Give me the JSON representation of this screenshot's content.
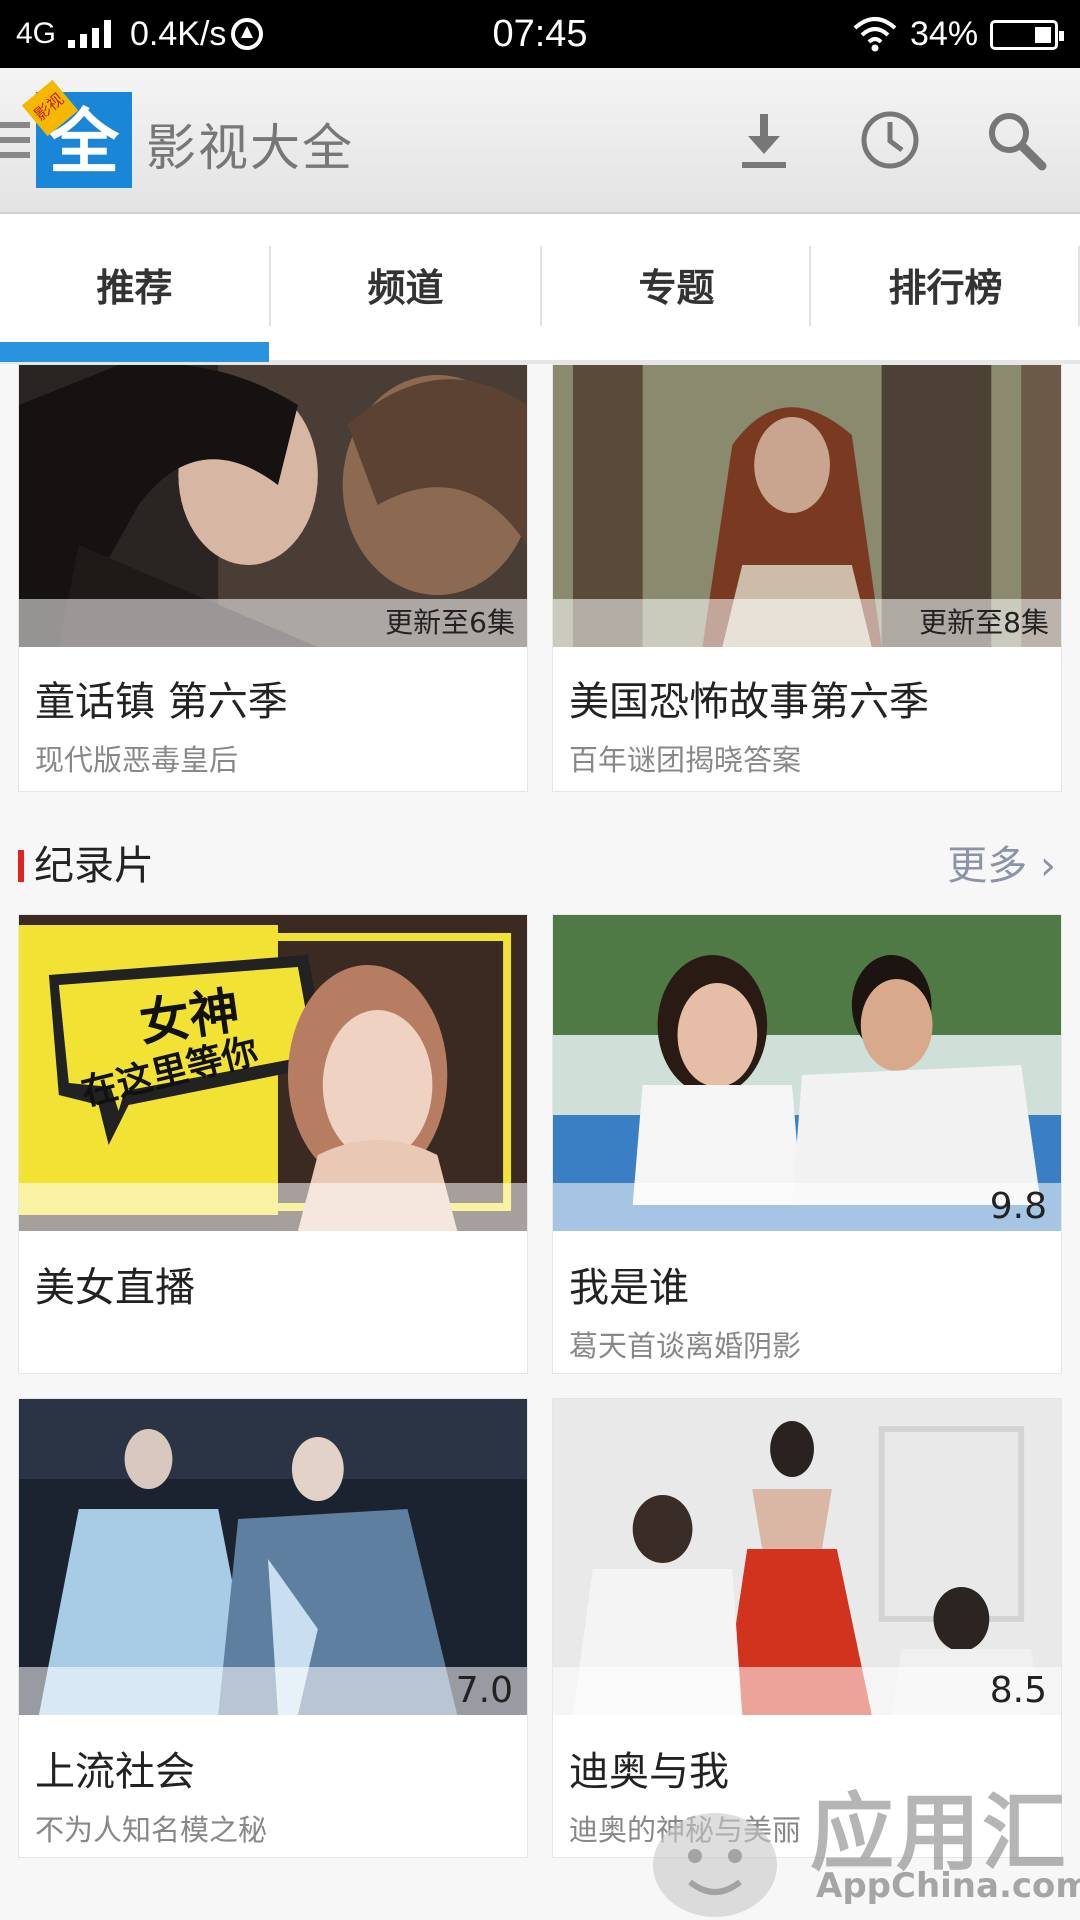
{
  "status_bar": {
    "network": "4G",
    "speed": "0.4K/s",
    "time": "07:45",
    "battery": "34%"
  },
  "app_bar": {
    "logo_char": "全",
    "logo_tag": "影视",
    "title": "影视大全"
  },
  "tabs": [
    "推荐",
    "频道",
    "专题",
    "排行榜"
  ],
  "top_cards": [
    {
      "title": "童话镇 第六季",
      "subtitle": "现代版恶毒皇后",
      "badge": "更新至6集"
    },
    {
      "title": "美国恐怖故事第六季",
      "subtitle": "百年谜团揭晓答案",
      "badge": "更新至8集"
    }
  ],
  "section": {
    "title": "纪录片",
    "more": "更多"
  },
  "doc_cards": [
    {
      "title": "美女直播",
      "subtitle": "",
      "score": "",
      "poster_text_1": "女神",
      "poster_text_2": "在这里等你"
    },
    {
      "title": "我是谁",
      "subtitle": "葛天首谈离婚阴影",
      "score": "9.8"
    },
    {
      "title": "上流社会",
      "subtitle": "不为人知名模之秘",
      "score": "7.0"
    },
    {
      "title": "迪奥与我",
      "subtitle": "迪奥的神秘与美丽",
      "score": "8.5"
    }
  ],
  "watermark": {
    "text": "应用汇",
    "sub": "AppChina.com"
  },
  "colors": {
    "accent": "#2a93dd",
    "logo_blue": "#1a86d8",
    "section_marker": "#e02424",
    "more_link": "#8b93a8"
  }
}
